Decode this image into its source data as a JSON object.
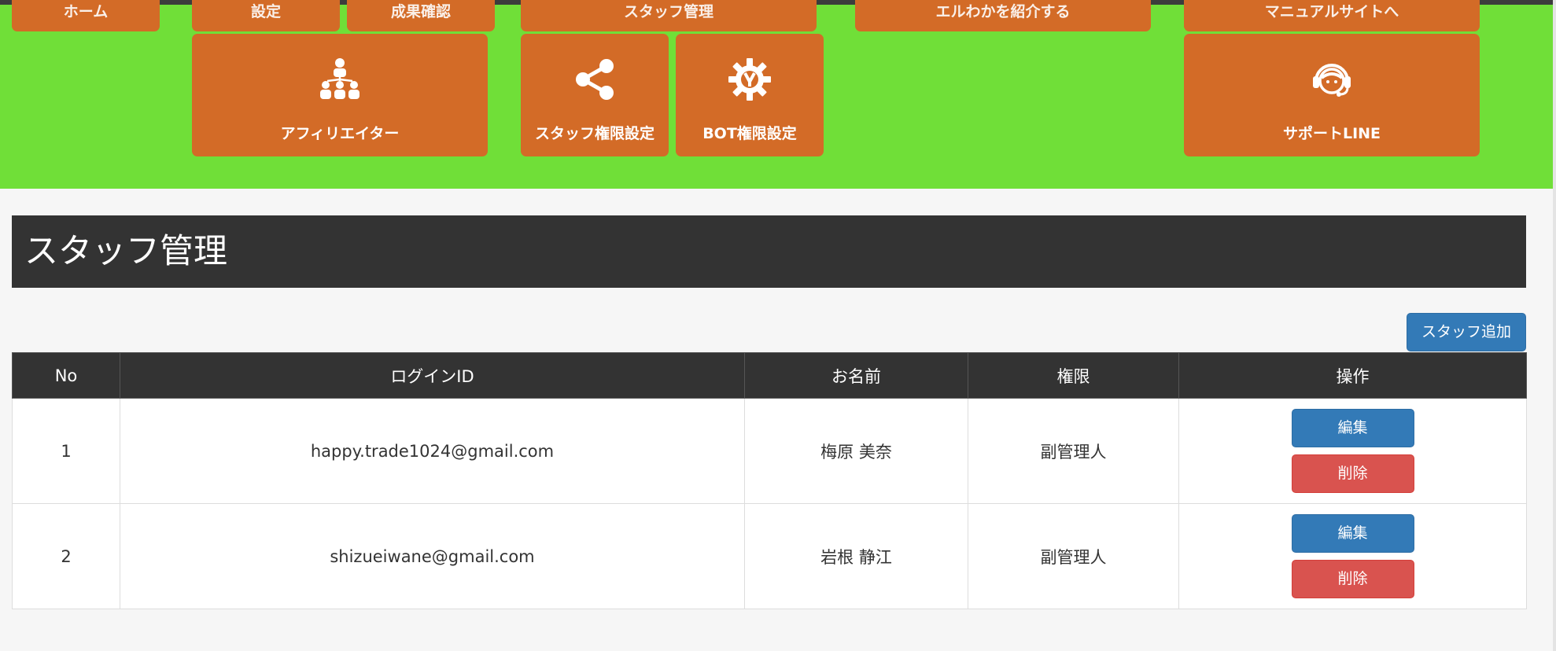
{
  "nav": {
    "cut_tiles": [
      "ホーム",
      "設定",
      "成果確認",
      "スタッフ管理",
      "エルわかを紹介する",
      "マニュアルサイトへ"
    ],
    "tiles": [
      {
        "label": "アフィリエイター",
        "icon": "affiliate-icon"
      },
      {
        "label": "スタッフ権限設定",
        "icon": "share-icon"
      },
      {
        "label": "BOT権限設定",
        "icon": "gear-icon"
      },
      {
        "label": "サポートLINE",
        "icon": "headset-icon"
      }
    ]
  },
  "page": {
    "title": "スタッフ管理",
    "add_button": "スタッフ追加"
  },
  "table": {
    "headers": [
      "No",
      "ログインID",
      "お名前",
      "権限",
      "操作"
    ],
    "rows": [
      {
        "no": "1",
        "login_id": "happy.trade1024@gmail.com",
        "name": "梅原 美奈",
        "role": "副管理人",
        "edit": "編集",
        "delete": "削除"
      },
      {
        "no": "2",
        "login_id": "shizueiwane@gmail.com",
        "name": "岩根 静江",
        "role": "副管理人",
        "edit": "編集",
        "delete": "削除"
      }
    ]
  },
  "colors": {
    "menu_bg": "#70df38",
    "tile": "#d36b27",
    "header_bg": "#333333",
    "primary": "#337ab7",
    "danger": "#d9534f"
  }
}
